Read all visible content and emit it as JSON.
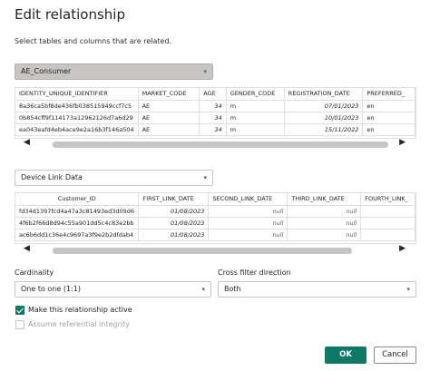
{
  "dialog": {
    "title": "Edit relationship",
    "subtitle": "Select tables and columns that are related."
  },
  "table1": {
    "selected": "AE_Consumer",
    "columns": [
      "IDENTITY_UNIQUE_IDENTIFIER",
      "MARKET_CODE",
      "AGE",
      "GENDER_CODE",
      "REGISTRATION_DATE",
      "PREFERRED_"
    ],
    "rows": [
      [
        "8a36ca5bf8de436fb038515949ccf7c5",
        "AE",
        "34",
        "m",
        "07/01/2023",
        "en"
      ],
      [
        "0b854cff9f114173a12962126d7a6d29",
        "AE",
        "34",
        "m",
        "10/01/2023",
        "en"
      ],
      [
        "ea043eafd4eb4ace9e2a16b3f146a504",
        "AE",
        "34",
        "m",
        "15/11/2022",
        "en"
      ]
    ]
  },
  "table2": {
    "selected": "Device Link Data",
    "columns": [
      "Customer_ID",
      "FIRST_LINK_DATE",
      "SECOND_LINK_DATE",
      "THIRD_LINK_DATE",
      "FOURTH_LINK_"
    ],
    "rows": [
      [
        "fd34d1397fcd4a47a3c81493ed3d09d6",
        "01/08/2023",
        "null",
        "null",
        ""
      ],
      [
        "4f6b2f66d8d94c55a901dd5c4c83e2bb",
        "01/08/2023",
        "null",
        "null",
        ""
      ],
      [
        "ac6b6dd1c36e4c9697a3f9e2b2dfdab4",
        "01/08/2023",
        "null",
        "null",
        ""
      ]
    ]
  },
  "cardinality": {
    "label": "Cardinality",
    "value": "One to one (1:1)"
  },
  "cross_filter": {
    "label": "Cross filter direction",
    "value": "Both"
  },
  "options": {
    "active_label": "Make this relationship active",
    "active_checked": true,
    "integrity_label": "Assume referential integrity",
    "integrity_checked": false
  },
  "buttons": {
    "ok": "OK",
    "cancel": "Cancel"
  },
  "colors": {
    "accent": "#117865"
  },
  "icons": {
    "dropdown": "chevron-down-icon",
    "scroll_left": "chevron-left-icon",
    "scroll_right": "chevron-right-icon",
    "checkmark": "checkmark-icon"
  }
}
